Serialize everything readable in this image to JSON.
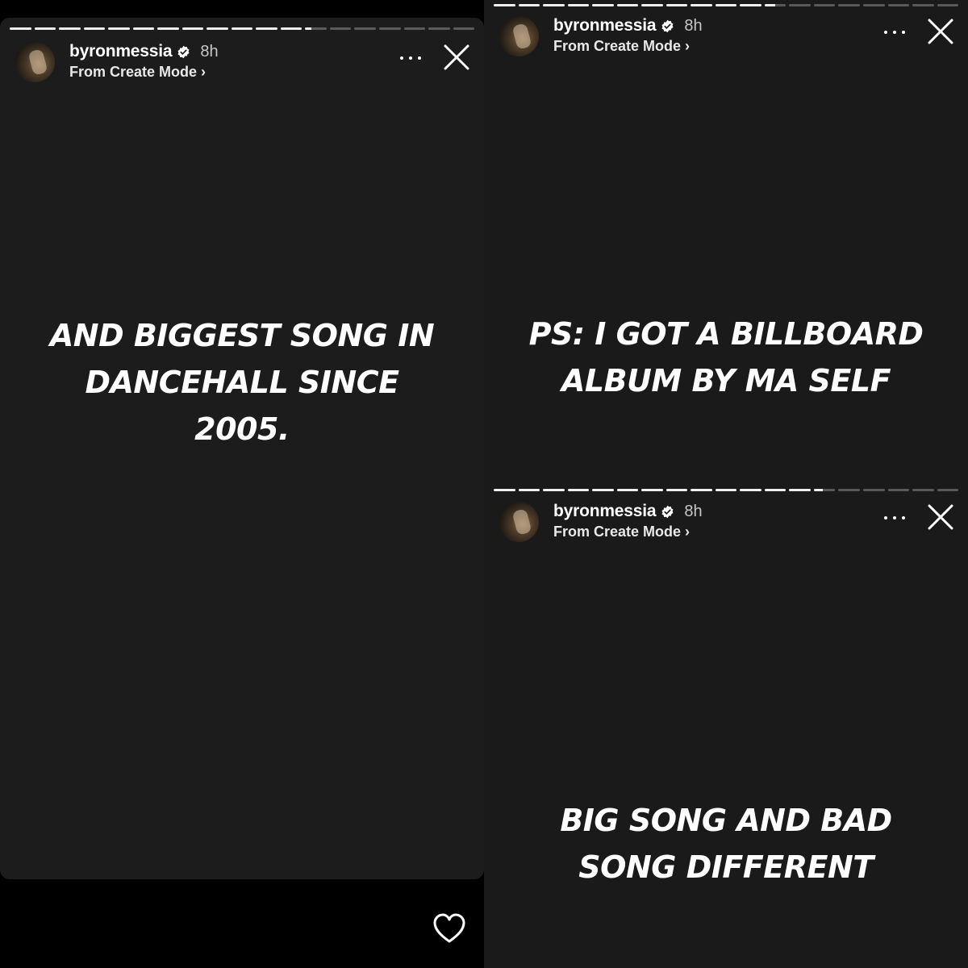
{
  "stories": [
    {
      "username": "byronmessia",
      "time": "8h",
      "subtitle": "From Create Mode",
      "text_lines": [
        "AND BIGGEST SONG IN",
        "DANCEHALL SINCE",
        "2005."
      ],
      "progress": {
        "segments": 19,
        "completed": 12,
        "current_fraction": 0.3
      }
    },
    {
      "username": "byronmessia",
      "time": "8h",
      "subtitle": "From Create Mode",
      "text_lines": [
        "PS: I GOT A BILLBOARD",
        "ALBUM BY MA SELF"
      ],
      "progress": {
        "segments": 19,
        "completed": 11,
        "current_fraction": 0.5
      }
    },
    {
      "username": "byronmessia",
      "time": "8h",
      "subtitle": "From Create Mode",
      "text_lines": [
        "BIG SONG AND BAD",
        "SONG DIFFERENT"
      ],
      "progress": {
        "segments": 19,
        "completed": 13,
        "current_fraction": 0.4
      }
    }
  ],
  "icons": {
    "more": "more-options-icon",
    "close": "close-icon",
    "verified": "verified-badge-icon",
    "like": "heart-icon",
    "chevron": "chevron-right-icon"
  },
  "colors": {
    "background": "#000000",
    "story_bg": "#1c1c1c",
    "text": "#ffffff"
  }
}
